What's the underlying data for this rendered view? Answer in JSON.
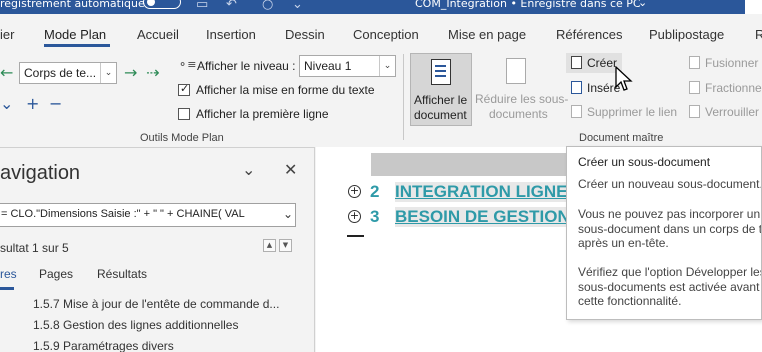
{
  "titlebar": {
    "autosave_label": "registrement automatique",
    "doc_title": "COM_Integration • Enregistré dans ce PC",
    "title_chevron": "⌄"
  },
  "tabs": {
    "items": [
      "ier",
      "Mode Plan",
      "Accueil",
      "Insertion",
      "Dessin",
      "Conception",
      "Mise en page",
      "Références",
      "Publipostage",
      "R"
    ],
    "active": "Mode Plan"
  },
  "outline_tools": {
    "level_combo_value": "Corps de te...",
    "show_level_label": "Afficher le niveau :",
    "show_level_value": "Niveau 1",
    "show_formatting_label": "Afficher la mise en forme du texte",
    "show_formatting_checked": true,
    "first_line_label": "Afficher la première ligne",
    "first_line_checked": false,
    "group_label": "Outils Mode Plan"
  },
  "master_document": {
    "show_document_label_1": "Afficher le",
    "show_document_label_2": "document",
    "reduce_label_1": "Réduire les sous-",
    "reduce_label_2": "documents",
    "create_label": "Créer",
    "insert_label": "Insére",
    "remove_link_label": "Supprimer le lien",
    "merge_label": "Fusionner",
    "split_label": "Fractionne",
    "lock_label": "Verrouiller",
    "group_label": "Document maître"
  },
  "navigation": {
    "title": "avigation",
    "search_value": "= CLO.\"Dimensions Saisie :\" + \" \" + CHAINE( VAL",
    "result_count": "sultat 1 sur 5",
    "tabs": [
      "res",
      "Pages",
      "Résultats"
    ],
    "items": [
      "1.5.7 Mise à jour de l'entête de commande d...",
      "1.5.8 Gestion des lignes additionnelles",
      "1.5.9 Paramétrages divers"
    ]
  },
  "document": {
    "headings": [
      {
        "number": "2",
        "text": "INTEGRATION LIGNE"
      },
      {
        "number": "3",
        "text": "BESOIN DE GESTION"
      }
    ]
  },
  "tooltip": {
    "title": "Créer un sous-document",
    "line1": "Créer un nouveau sous-document.",
    "para2": [
      "Vous ne pouvez pas incorporer un",
      "sous-document dans un corps de t",
      "après un en-tête."
    ],
    "para3": [
      "Vérifiez que l'option Développer les",
      "sous-documents est activée avant d",
      "cette fonctionnalité."
    ]
  },
  "colors": {
    "word_blue": "#2b579a",
    "heading_teal": "#2e9aa8",
    "arrow_green": "#2e8b57"
  }
}
